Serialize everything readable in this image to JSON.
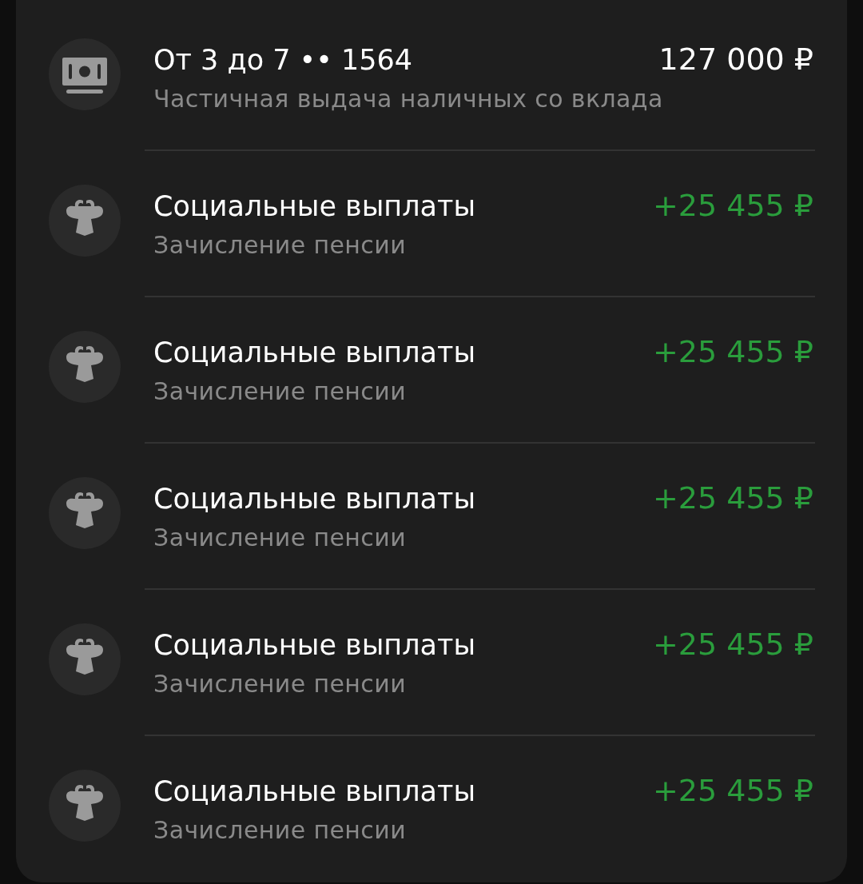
{
  "transactions": [
    {
      "kind": "withdrawal",
      "title": "От 3 до 7 •• 1564",
      "subtitle": "Частичная выдача наличных со вклада",
      "amount": "127 000 ₽"
    },
    {
      "kind": "pension",
      "title": "Социальные выплаты",
      "subtitle": "Зачисление пенсии",
      "amount": "+25 455 ₽"
    },
    {
      "kind": "pension",
      "title": "Социальные выплаты",
      "subtitle": "Зачисление пенсии",
      "amount": "+25 455 ₽"
    },
    {
      "kind": "pension",
      "title": "Социальные выплаты",
      "subtitle": "Зачисление пенсии",
      "amount": "+25 455 ₽"
    },
    {
      "kind": "pension",
      "title": "Социальные выплаты",
      "subtitle": "Зачисление пенсии",
      "amount": "+25 455 ₽"
    },
    {
      "kind": "pension",
      "title": "Социальные выплаты",
      "subtitle": "Зачисление пенсии",
      "amount": "+25 455 ₽"
    }
  ]
}
